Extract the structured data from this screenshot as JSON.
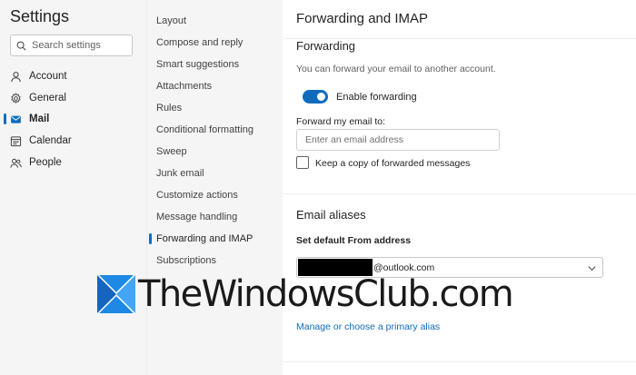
{
  "sidebar": {
    "title": "Settings",
    "search_placeholder": "Search settings",
    "items": [
      {
        "label": "Account",
        "icon": "person-icon"
      },
      {
        "label": "General",
        "icon": "gear-icon"
      },
      {
        "label": "Mail",
        "icon": "mail-icon",
        "active": true
      },
      {
        "label": "Calendar",
        "icon": "calendar-icon"
      },
      {
        "label": "People",
        "icon": "people-icon"
      }
    ]
  },
  "submenu": {
    "items": [
      {
        "label": "Layout"
      },
      {
        "label": "Compose and reply"
      },
      {
        "label": "Smart suggestions"
      },
      {
        "label": "Attachments"
      },
      {
        "label": "Rules"
      },
      {
        "label": "Conditional formatting"
      },
      {
        "label": "Sweep"
      },
      {
        "label": "Junk email"
      },
      {
        "label": "Customize actions"
      },
      {
        "label": "Message handling"
      },
      {
        "label": "Forwarding and IMAP",
        "active": true
      },
      {
        "label": "Subscriptions"
      }
    ]
  },
  "main": {
    "title": "Forwarding and IMAP",
    "forwarding": {
      "heading": "Forwarding",
      "description": "You can forward your email to another account.",
      "toggle_label": "Enable forwarding",
      "toggle_on": true,
      "forward_label": "Forward my email to:",
      "email_placeholder": "Enter an email address",
      "keep_copy_label": "Keep a copy of forwarded messages",
      "keep_copy_checked": false
    },
    "aliases": {
      "heading": "Email aliases",
      "default_from_label": "Set default From address",
      "selected_address": "@outlook.com",
      "manage_link": "Manage or choose a primary alias"
    }
  },
  "watermark": {
    "text": "TheWindowsClub.com"
  },
  "colors": {
    "accent": "#0f6cbd",
    "pane_bg": "#f5f5f5",
    "watermark_blue": "#1e88e5"
  }
}
